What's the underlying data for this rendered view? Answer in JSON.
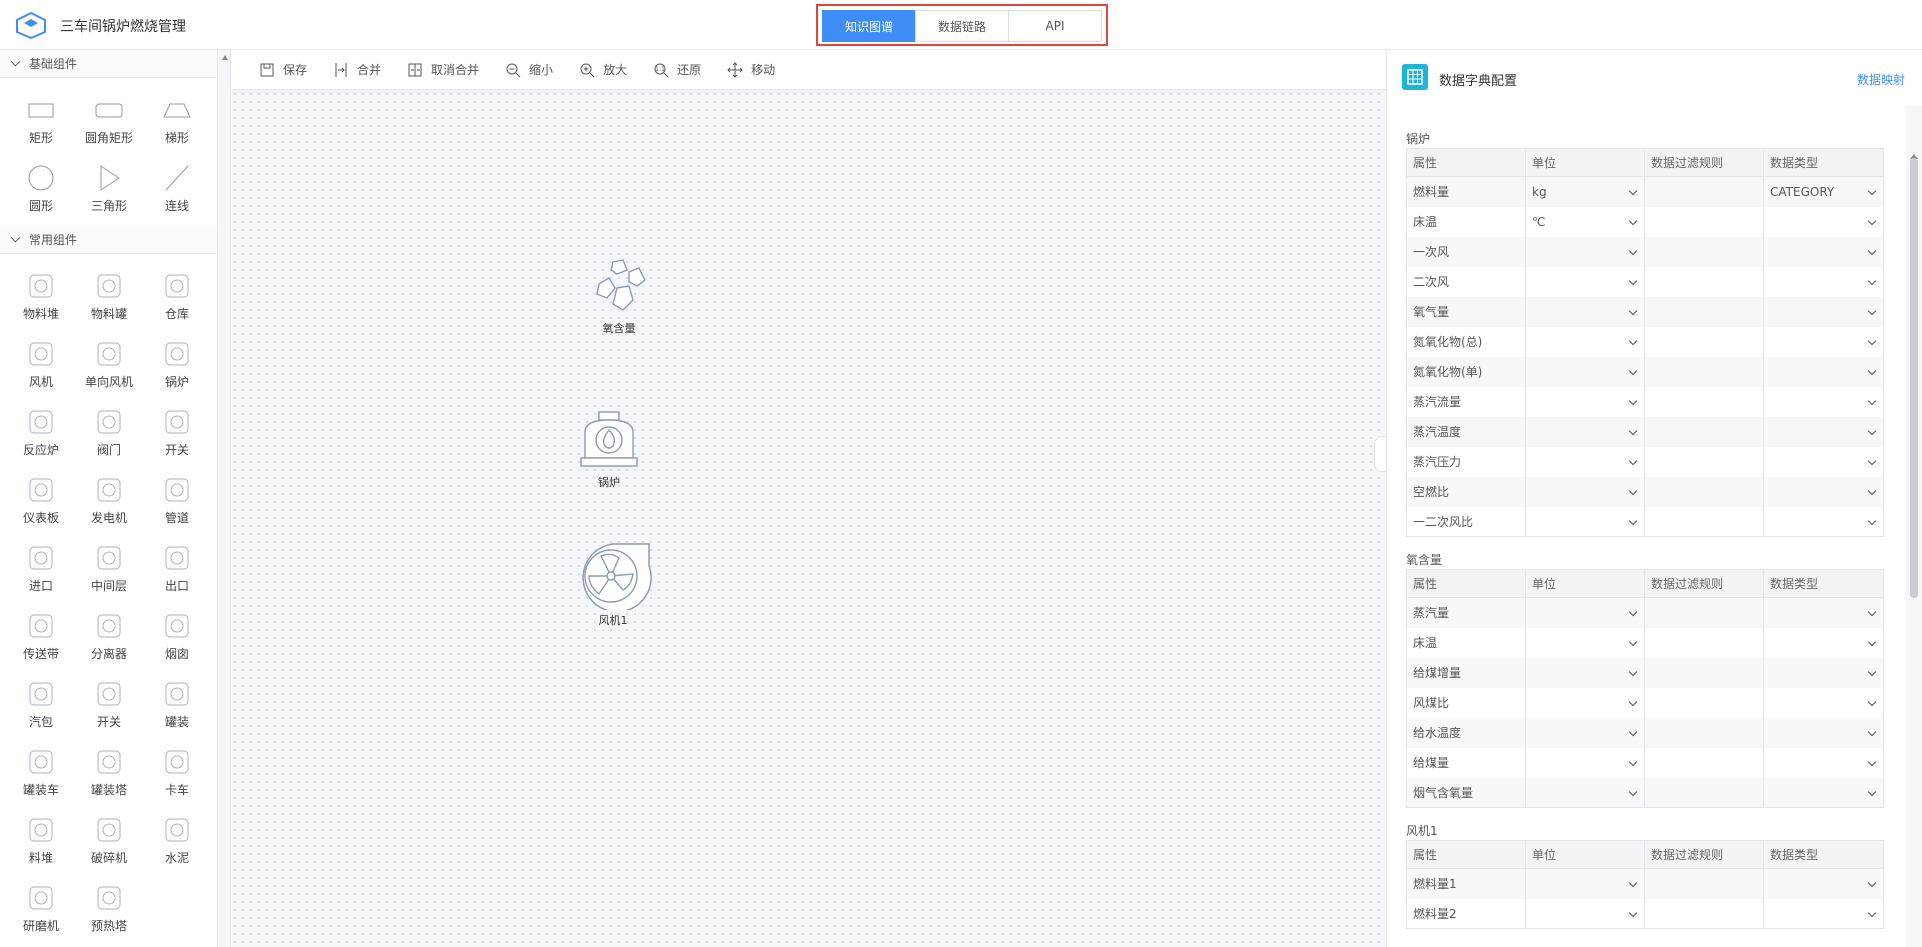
{
  "app": {
    "title": "三车间锅炉燃烧管理"
  },
  "tabs": [
    {
      "label": "知识图谱",
      "active": true
    },
    {
      "label": "数据链路",
      "active": false
    },
    {
      "label": "API",
      "active": false
    }
  ],
  "left": {
    "basic": {
      "title": "基础组件",
      "items": [
        {
          "label": "矩形",
          "icon": "rectangle-icon"
        },
        {
          "label": "圆角矩形",
          "icon": "rounded-rectangle-icon"
        },
        {
          "label": "梯形",
          "icon": "trapezoid-icon"
        },
        {
          "label": "圆形",
          "icon": "circle-icon"
        },
        {
          "label": "三角形",
          "icon": "triangle-icon"
        },
        {
          "label": "连线",
          "icon": "line-icon"
        }
      ]
    },
    "common": {
      "title": "常用组件",
      "items": [
        {
          "label": "物料堆",
          "icon": "material-pile-icon"
        },
        {
          "label": "物料罐",
          "icon": "material-tank-icon"
        },
        {
          "label": "仓库",
          "icon": "warehouse-icon"
        },
        {
          "label": "风机",
          "icon": "fan-icon"
        },
        {
          "label": "单向风机",
          "icon": "oneway-fan-icon"
        },
        {
          "label": "锅炉",
          "icon": "boiler-icon"
        },
        {
          "label": "反应炉",
          "icon": "reactor-icon"
        },
        {
          "label": "阀门",
          "icon": "valve-icon"
        },
        {
          "label": "开关",
          "icon": "switch-icon"
        },
        {
          "label": "仪表板",
          "icon": "dashboard-icon"
        },
        {
          "label": "发电机",
          "icon": "generator-icon"
        },
        {
          "label": "管道",
          "icon": "pipe-icon"
        },
        {
          "label": "进口",
          "icon": "inlet-icon"
        },
        {
          "label": "中间层",
          "icon": "middle-layer-icon"
        },
        {
          "label": "出口",
          "icon": "outlet-icon"
        },
        {
          "label": "传送带",
          "icon": "conveyor-icon"
        },
        {
          "label": "分离器",
          "icon": "separator-icon"
        },
        {
          "label": "烟囱",
          "icon": "chimney-icon"
        },
        {
          "label": "汽包",
          "icon": "steam-drum-icon"
        },
        {
          "label": "开关",
          "icon": "switch2-icon"
        },
        {
          "label": "罐装",
          "icon": "canning-icon"
        },
        {
          "label": "罐装车",
          "icon": "tank-truck-icon"
        },
        {
          "label": "罐装塔",
          "icon": "tank-tower-icon"
        },
        {
          "label": "卡车",
          "icon": "truck-icon"
        },
        {
          "label": "料堆",
          "icon": "stockpile-icon"
        },
        {
          "label": "破碎机",
          "icon": "crusher-icon"
        },
        {
          "label": "水泥",
          "icon": "cement-icon"
        },
        {
          "label": "研磨机",
          "icon": "grinder-icon"
        },
        {
          "label": "预热塔",
          "icon": "preheat-tower-icon"
        }
      ]
    }
  },
  "toolbar": [
    {
      "label": "保存",
      "icon": "save-icon"
    },
    {
      "label": "合并",
      "icon": "merge-icon"
    },
    {
      "label": "取消合并",
      "icon": "unmerge-icon"
    },
    {
      "label": "缩小",
      "icon": "zoom-out-icon"
    },
    {
      "label": "放大",
      "icon": "zoom-in-icon"
    },
    {
      "label": "还原",
      "icon": "reset-zoom-icon"
    },
    {
      "label": "移动",
      "icon": "move-icon"
    }
  ],
  "canvas": {
    "nodes": [
      {
        "label": "氧含量",
        "icon": "material-pile-icon"
      },
      {
        "label": "锅炉",
        "icon": "boiler-icon"
      },
      {
        "label": "风机1",
        "icon": "fan-icon"
      }
    ]
  },
  "right": {
    "title": "数据字典配置",
    "link": "数据映射",
    "columns": [
      "属性",
      "单位",
      "数据过滤规则",
      "数据类型"
    ],
    "groups": [
      {
        "name": "锅炉",
        "rows": [
          {
            "attr": "燃料量",
            "unit": "kg",
            "rule": "",
            "type": "CATEGORY"
          },
          {
            "attr": "床温",
            "unit": "℃",
            "rule": "",
            "type": ""
          },
          {
            "attr": "一次风",
            "unit": "",
            "rule": "",
            "type": ""
          },
          {
            "attr": "二次风",
            "unit": "",
            "rule": "",
            "type": ""
          },
          {
            "attr": "氧气量",
            "unit": "",
            "rule": "",
            "type": ""
          },
          {
            "attr": "氮氧化物(总)",
            "unit": "",
            "rule": "",
            "type": ""
          },
          {
            "attr": "氮氧化物(单)",
            "unit": "",
            "rule": "",
            "type": ""
          },
          {
            "attr": "蒸汽流量",
            "unit": "",
            "rule": "",
            "type": ""
          },
          {
            "attr": "蒸汽温度",
            "unit": "",
            "rule": "",
            "type": ""
          },
          {
            "attr": "蒸汽压力",
            "unit": "",
            "rule": "",
            "type": ""
          },
          {
            "attr": "空燃比",
            "unit": "",
            "rule": "",
            "type": ""
          },
          {
            "attr": "一二次风比",
            "unit": "",
            "rule": "",
            "type": ""
          }
        ]
      },
      {
        "name": "氧含量",
        "rows": [
          {
            "attr": "蒸汽量",
            "unit": "",
            "rule": "",
            "type": ""
          },
          {
            "attr": "床温",
            "unit": "",
            "rule": "",
            "type": ""
          },
          {
            "attr": "给煤增量",
            "unit": "",
            "rule": "",
            "type": ""
          },
          {
            "attr": "风煤比",
            "unit": "",
            "rule": "",
            "type": ""
          },
          {
            "attr": "给水温度",
            "unit": "",
            "rule": "",
            "type": ""
          },
          {
            "attr": "给煤量",
            "unit": "",
            "rule": "",
            "type": ""
          },
          {
            "attr": "烟气含氧量",
            "unit": "",
            "rule": "",
            "type": ""
          }
        ]
      },
      {
        "name": "风机1",
        "rows": [
          {
            "attr": "燃料量1",
            "unit": "",
            "rule": "",
            "type": ""
          },
          {
            "attr": "燃料量2",
            "unit": "",
            "rule": "",
            "type": ""
          }
        ]
      }
    ]
  }
}
